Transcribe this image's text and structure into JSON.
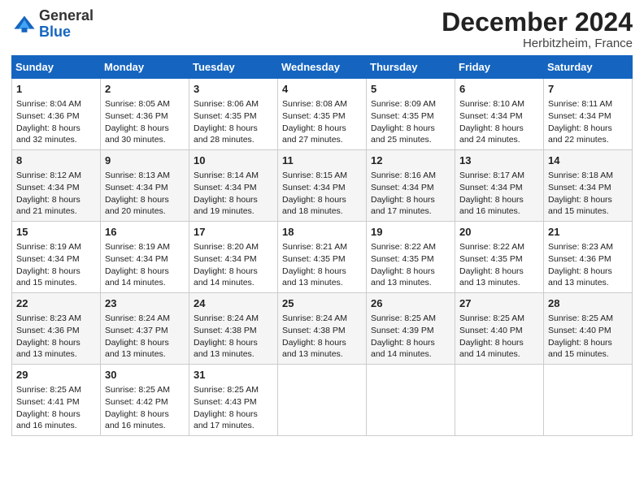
{
  "logo": {
    "general": "General",
    "blue": "Blue"
  },
  "title": {
    "month_year": "December 2024",
    "location": "Herbitzheim, France"
  },
  "days_of_week": [
    "Sunday",
    "Monday",
    "Tuesday",
    "Wednesday",
    "Thursday",
    "Friday",
    "Saturday"
  ],
  "weeks": [
    [
      {
        "day": "1",
        "sunrise": "Sunrise: 8:04 AM",
        "sunset": "Sunset: 4:36 PM",
        "daylight": "Daylight: 8 hours and 32 minutes."
      },
      {
        "day": "2",
        "sunrise": "Sunrise: 8:05 AM",
        "sunset": "Sunset: 4:36 PM",
        "daylight": "Daylight: 8 hours and 30 minutes."
      },
      {
        "day": "3",
        "sunrise": "Sunrise: 8:06 AM",
        "sunset": "Sunset: 4:35 PM",
        "daylight": "Daylight: 8 hours and 28 minutes."
      },
      {
        "day": "4",
        "sunrise": "Sunrise: 8:08 AM",
        "sunset": "Sunset: 4:35 PM",
        "daylight": "Daylight: 8 hours and 27 minutes."
      },
      {
        "day": "5",
        "sunrise": "Sunrise: 8:09 AM",
        "sunset": "Sunset: 4:35 PM",
        "daylight": "Daylight: 8 hours and 25 minutes."
      },
      {
        "day": "6",
        "sunrise": "Sunrise: 8:10 AM",
        "sunset": "Sunset: 4:34 PM",
        "daylight": "Daylight: 8 hours and 24 minutes."
      },
      {
        "day": "7",
        "sunrise": "Sunrise: 8:11 AM",
        "sunset": "Sunset: 4:34 PM",
        "daylight": "Daylight: 8 hours and 22 minutes."
      }
    ],
    [
      {
        "day": "8",
        "sunrise": "Sunrise: 8:12 AM",
        "sunset": "Sunset: 4:34 PM",
        "daylight": "Daylight: 8 hours and 21 minutes."
      },
      {
        "day": "9",
        "sunrise": "Sunrise: 8:13 AM",
        "sunset": "Sunset: 4:34 PM",
        "daylight": "Daylight: 8 hours and 20 minutes."
      },
      {
        "day": "10",
        "sunrise": "Sunrise: 8:14 AM",
        "sunset": "Sunset: 4:34 PM",
        "daylight": "Daylight: 8 hours and 19 minutes."
      },
      {
        "day": "11",
        "sunrise": "Sunrise: 8:15 AM",
        "sunset": "Sunset: 4:34 PM",
        "daylight": "Daylight: 8 hours and 18 minutes."
      },
      {
        "day": "12",
        "sunrise": "Sunrise: 8:16 AM",
        "sunset": "Sunset: 4:34 PM",
        "daylight": "Daylight: 8 hours and 17 minutes."
      },
      {
        "day": "13",
        "sunrise": "Sunrise: 8:17 AM",
        "sunset": "Sunset: 4:34 PM",
        "daylight": "Daylight: 8 hours and 16 minutes."
      },
      {
        "day": "14",
        "sunrise": "Sunrise: 8:18 AM",
        "sunset": "Sunset: 4:34 PM",
        "daylight": "Daylight: 8 hours and 15 minutes."
      }
    ],
    [
      {
        "day": "15",
        "sunrise": "Sunrise: 8:19 AM",
        "sunset": "Sunset: 4:34 PM",
        "daylight": "Daylight: 8 hours and 15 minutes."
      },
      {
        "day": "16",
        "sunrise": "Sunrise: 8:19 AM",
        "sunset": "Sunset: 4:34 PM",
        "daylight": "Daylight: 8 hours and 14 minutes."
      },
      {
        "day": "17",
        "sunrise": "Sunrise: 8:20 AM",
        "sunset": "Sunset: 4:34 PM",
        "daylight": "Daylight: 8 hours and 14 minutes."
      },
      {
        "day": "18",
        "sunrise": "Sunrise: 8:21 AM",
        "sunset": "Sunset: 4:35 PM",
        "daylight": "Daylight: 8 hours and 13 minutes."
      },
      {
        "day": "19",
        "sunrise": "Sunrise: 8:22 AM",
        "sunset": "Sunset: 4:35 PM",
        "daylight": "Daylight: 8 hours and 13 minutes."
      },
      {
        "day": "20",
        "sunrise": "Sunrise: 8:22 AM",
        "sunset": "Sunset: 4:35 PM",
        "daylight": "Daylight: 8 hours and 13 minutes."
      },
      {
        "day": "21",
        "sunrise": "Sunrise: 8:23 AM",
        "sunset": "Sunset: 4:36 PM",
        "daylight": "Daylight: 8 hours and 13 minutes."
      }
    ],
    [
      {
        "day": "22",
        "sunrise": "Sunrise: 8:23 AM",
        "sunset": "Sunset: 4:36 PM",
        "daylight": "Daylight: 8 hours and 13 minutes."
      },
      {
        "day": "23",
        "sunrise": "Sunrise: 8:24 AM",
        "sunset": "Sunset: 4:37 PM",
        "daylight": "Daylight: 8 hours and 13 minutes."
      },
      {
        "day": "24",
        "sunrise": "Sunrise: 8:24 AM",
        "sunset": "Sunset: 4:38 PM",
        "daylight": "Daylight: 8 hours and 13 minutes."
      },
      {
        "day": "25",
        "sunrise": "Sunrise: 8:24 AM",
        "sunset": "Sunset: 4:38 PM",
        "daylight": "Daylight: 8 hours and 13 minutes."
      },
      {
        "day": "26",
        "sunrise": "Sunrise: 8:25 AM",
        "sunset": "Sunset: 4:39 PM",
        "daylight": "Daylight: 8 hours and 14 minutes."
      },
      {
        "day": "27",
        "sunrise": "Sunrise: 8:25 AM",
        "sunset": "Sunset: 4:40 PM",
        "daylight": "Daylight: 8 hours and 14 minutes."
      },
      {
        "day": "28",
        "sunrise": "Sunrise: 8:25 AM",
        "sunset": "Sunset: 4:40 PM",
        "daylight": "Daylight: 8 hours and 15 minutes."
      }
    ],
    [
      {
        "day": "29",
        "sunrise": "Sunrise: 8:25 AM",
        "sunset": "Sunset: 4:41 PM",
        "daylight": "Daylight: 8 hours and 16 minutes."
      },
      {
        "day": "30",
        "sunrise": "Sunrise: 8:25 AM",
        "sunset": "Sunset: 4:42 PM",
        "daylight": "Daylight: 8 hours and 16 minutes."
      },
      {
        "day": "31",
        "sunrise": "Sunrise: 8:25 AM",
        "sunset": "Sunset: 4:43 PM",
        "daylight": "Daylight: 8 hours and 17 minutes."
      },
      null,
      null,
      null,
      null
    ]
  ]
}
